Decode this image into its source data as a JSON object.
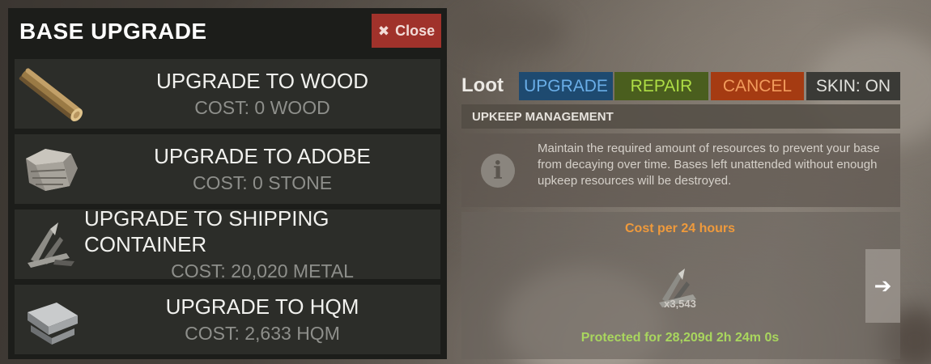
{
  "panel": {
    "title": "BASE UPGRADE",
    "close_label": "Close",
    "close_icon": "x-icon",
    "upgrades": [
      {
        "title": "UPGRADE TO WOOD",
        "cost": "COST: 0 WOOD",
        "icon": "wood-log-icon"
      },
      {
        "title": "UPGRADE TO ADOBE",
        "cost": "COST: 0 STONE",
        "icon": "stone-icon"
      },
      {
        "title": "UPGRADE TO SHIPPING CONTAINER",
        "cost": "COST: 20,020 METAL",
        "icon": "metal-fragments-icon"
      },
      {
        "title": "UPGRADE TO HQM",
        "cost": "COST: 2,633 HQM",
        "icon": "hqm-ingot-icon"
      }
    ]
  },
  "loot": {
    "label": "Loot",
    "buttons": {
      "upgrade": "UPGRADE",
      "repair": "REPAIR",
      "cancel": "CANCEL",
      "skin": "SKIN: ON"
    }
  },
  "upkeep": {
    "header": "UPKEEP MANAGEMENT",
    "info_text": "Maintain the required amount of resources to prevent your base from decaying over time. Bases left unattended without enough upkeep resources will be destroyed.",
    "info_icon": "info-icon",
    "cost_title": "Cost per 24 hours",
    "resource_icon": "metal-fragments-icon",
    "resource_amount": "x3,543",
    "protected": "Protected for 28,209d 2h 24m 0s",
    "next_icon": "arrow-right-icon"
  },
  "colors": {
    "upgrade": "#1e4a70",
    "repair": "#4a5e1e",
    "cancel": "#a53b12",
    "skin": "#3a3a36",
    "close": "#a0322b",
    "cost_title": "#ef9a3c",
    "protected": "#a9d65e"
  }
}
